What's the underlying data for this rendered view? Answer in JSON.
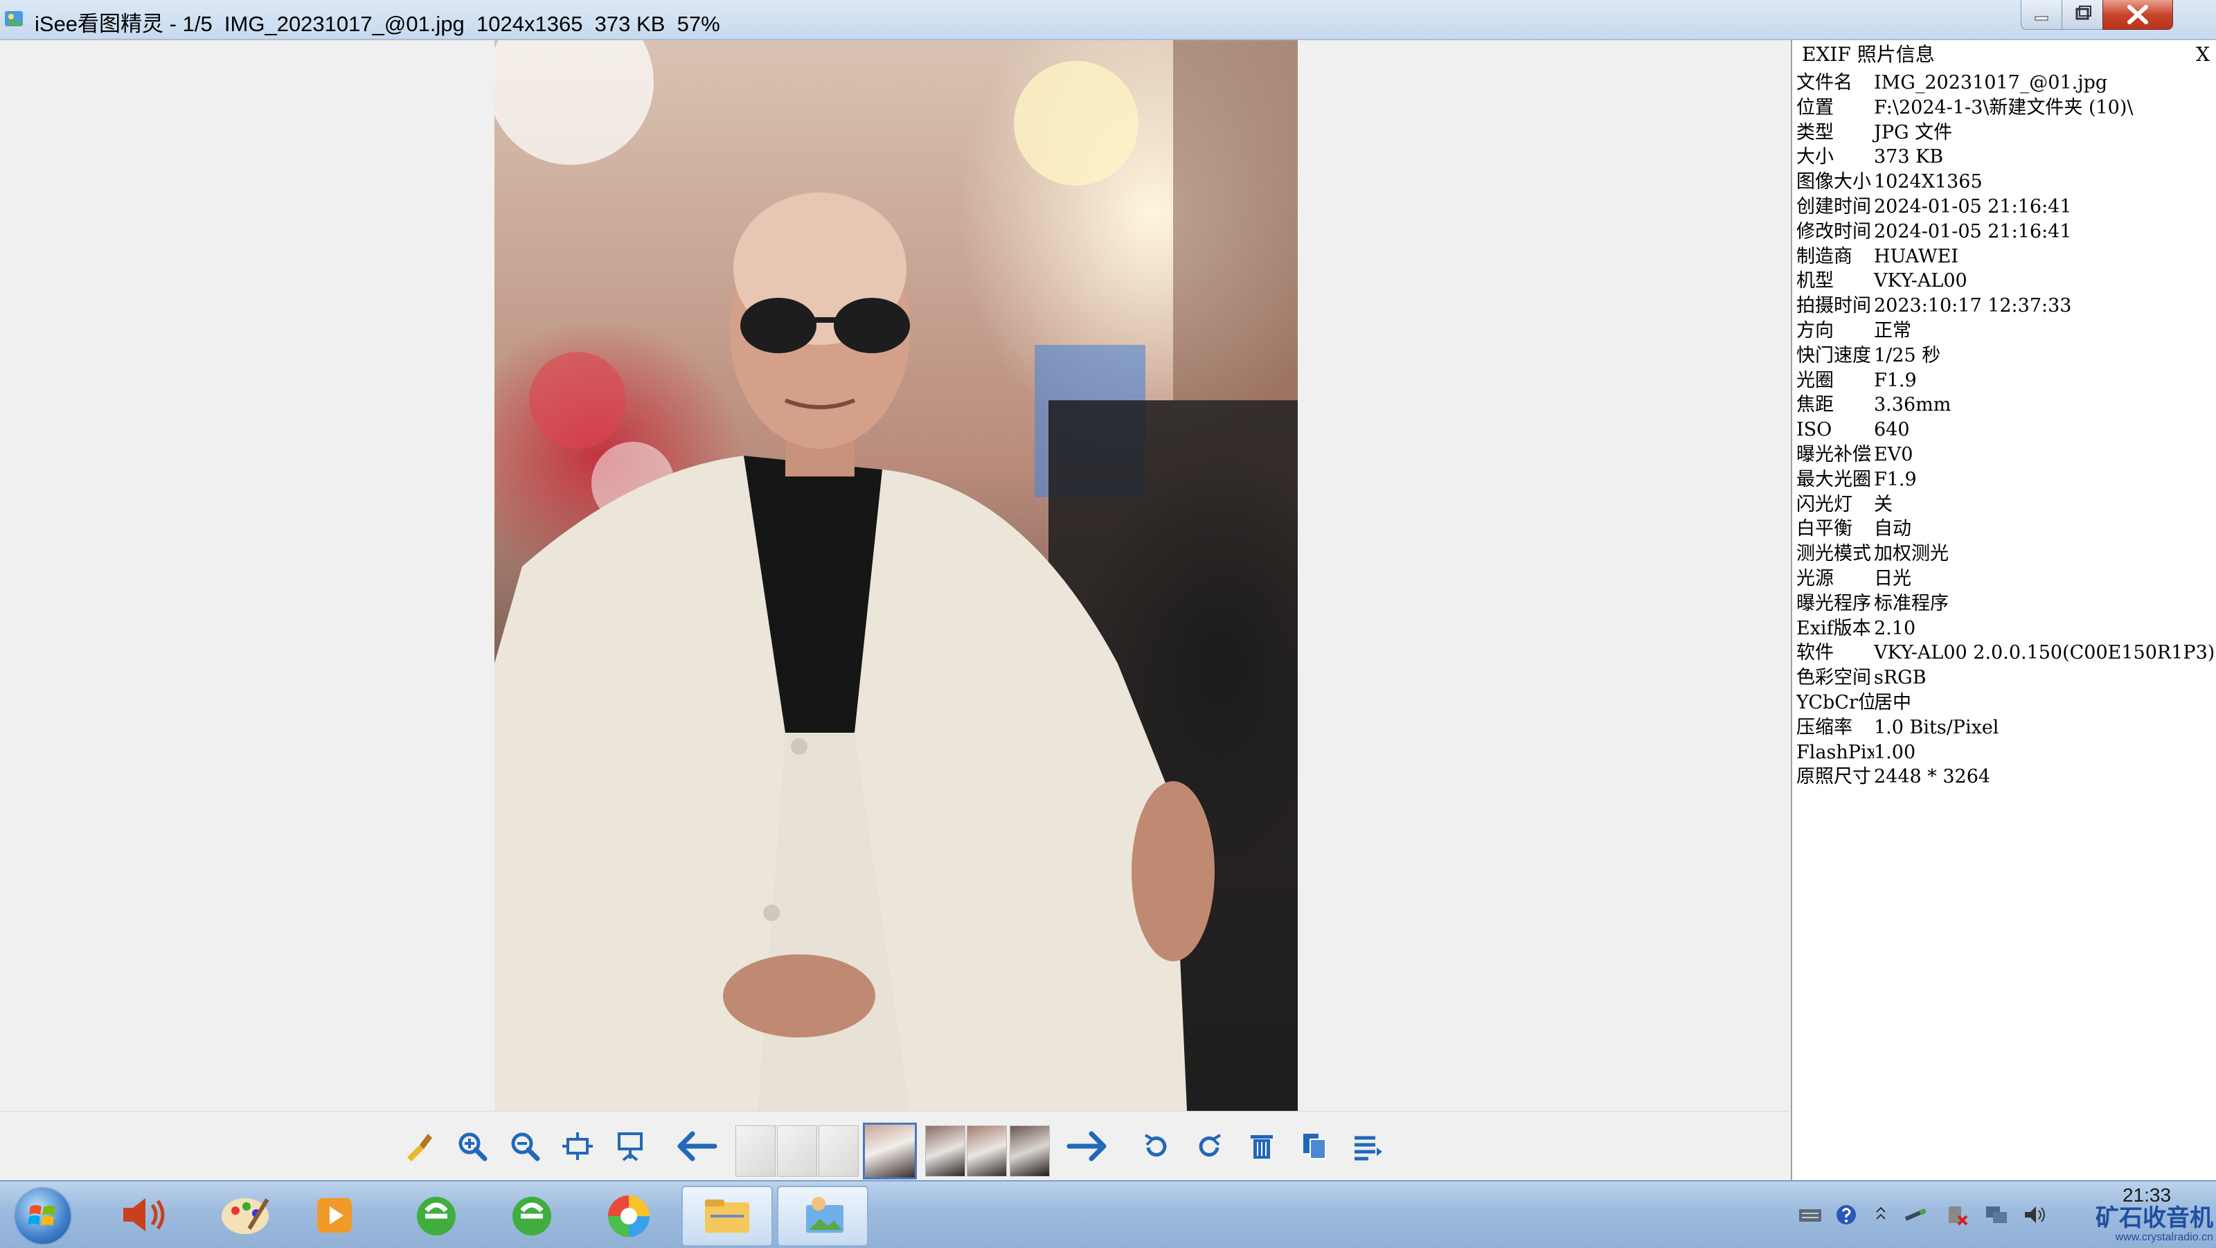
{
  "window": {
    "title": "iSee看图精灵 - 1/5  IMG_20231017_@01.jpg  1024x1365  373 KB  57%"
  },
  "exif_panel": {
    "title": "EXIF  照片信息",
    "close_label": "X",
    "rows": [
      {
        "key": "文件名",
        "value": "IMG_20231017_@01.jpg"
      },
      {
        "key": "位置",
        "value": "F:\\2024-1-3\\新建文件夹 (10)\\"
      },
      {
        "key": "类型",
        "value": "JPG 文件"
      },
      {
        "key": "大小",
        "value": "373 KB"
      },
      {
        "key": "图像大小",
        "value": "1024X1365"
      },
      {
        "key": "创建时间",
        "value": "2024-01-05 21:16:41"
      },
      {
        "key": "修改时间",
        "value": "2024-01-05 21:16:41"
      },
      {
        "key": "制造商",
        "value": "HUAWEI"
      },
      {
        "key": "机型",
        "value": "VKY-AL00"
      },
      {
        "key": "拍摄时间",
        "value": "2023:10:17 12:37:33"
      },
      {
        "key": "方向",
        "value": "正常"
      },
      {
        "key": "快门速度",
        "value": "1/25 秒"
      },
      {
        "key": "光圈",
        "value": "F1.9"
      },
      {
        "key": "焦距",
        "value": "3.36mm"
      },
      {
        "key": "ISO",
        "value": "640"
      },
      {
        "key": "曝光补偿",
        "value": "EV0"
      },
      {
        "key": "最大光圈",
        "value": "F1.9"
      },
      {
        "key": "闪光灯",
        "value": "关"
      },
      {
        "key": "白平衡",
        "value": "自动"
      },
      {
        "key": "测光模式",
        "value": "加权测光"
      },
      {
        "key": "光源",
        "value": "日光"
      },
      {
        "key": "曝光程序",
        "value": "标准程序"
      },
      {
        "key": "Exif版本",
        "value": "2.10"
      },
      {
        "key": "软件",
        "value": "VKY-AL00 2.0.0.150(C00E150R1P3)"
      },
      {
        "key": "色彩空间",
        "value": "sRGB"
      },
      {
        "key": "YCbCr位置",
        "value": "居中"
      },
      {
        "key": "压缩率",
        "value": "1.0 Bits/Pixel"
      },
      {
        "key": "FlashPix",
        "value": "1.00"
      },
      {
        "key": "原照尺寸",
        "value": "2448 * 3264"
      }
    ]
  },
  "toolbar": {
    "icons": [
      "edit-brush-icon",
      "zoom-in-icon",
      "zoom-out-icon",
      "fit-window-icon",
      "slideshow-icon",
      "prev-arrow-icon",
      "next-arrow-icon",
      "rotate-left-icon",
      "rotate-right-icon",
      "delete-icon",
      "copy-icon",
      "menu-icon"
    ]
  },
  "taskbar": {
    "clock_time": "21:33",
    "watermark": "矿石收音机",
    "watermark_url": "www.crystalradio.cn",
    "colors": {
      "accent": "#3f7fc8",
      "close_button": "#c8452c"
    }
  }
}
